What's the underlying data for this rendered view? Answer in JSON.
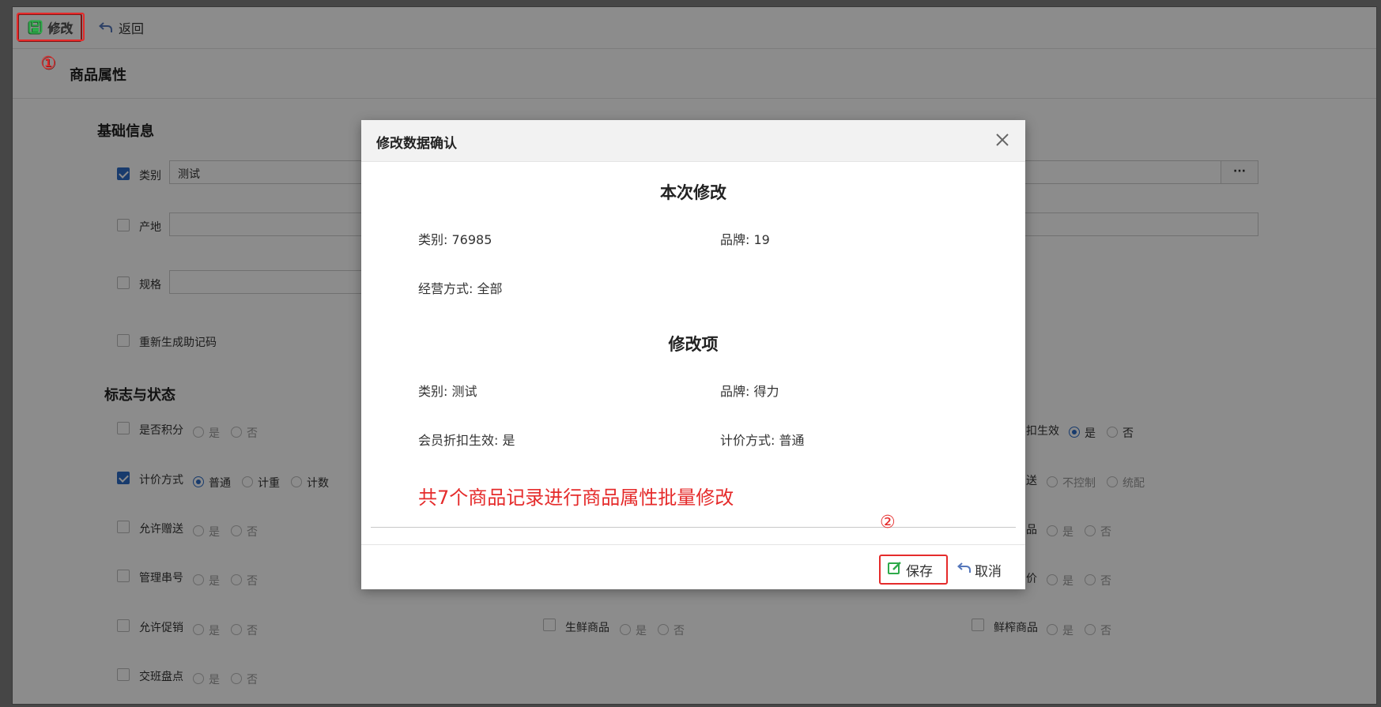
{
  "toolbar": {
    "edit_label": "修改",
    "back_label": "返回"
  },
  "markers": {
    "one": "①",
    "two": "②"
  },
  "page_title": "商品属性",
  "basic": {
    "title": "基础信息",
    "category_label": "类别",
    "category_value": "测试",
    "origin_label": "产地",
    "spec_label": "规格",
    "regen_label": "重新生成助记码",
    "more_button": "···"
  },
  "status": {
    "title": "标志与状态",
    "rows": [
      {
        "label": "是否积分",
        "checked": false,
        "opts": [
          "是",
          "否"
        ]
      },
      {
        "label": "计价方式",
        "checked": true,
        "opts": [
          "普通",
          "计重",
          "计数"
        ],
        "selected": 0
      },
      {
        "label": "允许赠送",
        "checked": false,
        "opts": [
          "是",
          "否"
        ]
      },
      {
        "label": "管理串号",
        "checked": false,
        "opts": [
          "是",
          "否"
        ]
      },
      {
        "label": "允许促销",
        "checked": false,
        "opts": [
          "是",
          "否"
        ]
      },
      {
        "label": "交班盘点",
        "checked": false,
        "opts": [
          "是",
          "否"
        ]
      }
    ],
    "mid_row": {
      "label": "生鲜商品",
      "opts": [
        "是",
        "否"
      ]
    },
    "right": [
      {
        "label": "扣生效",
        "opts": [
          "是",
          "否"
        ],
        "selected": 0
      },
      {
        "label": "送",
        "opts": [
          "不控制",
          "统配"
        ]
      },
      {
        "label": "品",
        "opts": [
          "是",
          "否"
        ]
      },
      {
        "label": "价",
        "opts": [
          "是",
          "否"
        ]
      },
      {
        "label": "鲜榨商品",
        "opts": [
          "是",
          "否"
        ]
      }
    ]
  },
  "modal": {
    "title": "修改数据确认",
    "section_current": "本次修改",
    "current_items": [
      "类别: 76985",
      "品牌: 19",
      "经营方式: 全部"
    ],
    "section_changes": "修改项",
    "change_items": [
      "类别: 测试",
      "品牌: 得力",
      "会员折扣生效: 是",
      "计价方式: 普通"
    ],
    "note": "共7个商品记录进行商品属性批量修改",
    "save_label": "保存",
    "cancel_label": "取消"
  },
  "colors": {
    "highlight": "#e52b2b",
    "accent": "#2d6cc6",
    "save_icon": "#2eaa4a"
  }
}
